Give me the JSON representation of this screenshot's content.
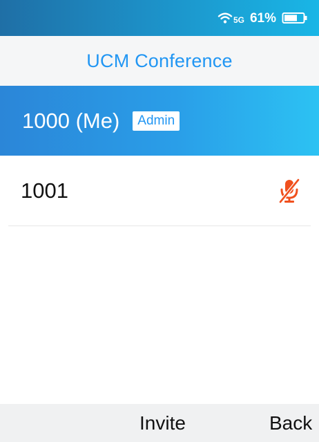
{
  "status_bar": {
    "wifi_label": "5G",
    "battery_percent": "61%",
    "icons": [
      "wifi-icon",
      "battery-icon"
    ]
  },
  "header": {
    "title": "UCM Conference"
  },
  "participants": [
    {
      "label": "1000 (Me)",
      "badge": "Admin",
      "selected": true,
      "muted": false
    },
    {
      "label": "1001",
      "badge": "",
      "selected": false,
      "muted": true,
      "status_icon": "mic-muted-icon"
    }
  ],
  "softkeys": {
    "left": "",
    "middle": "Invite",
    "right": "Back"
  },
  "colors": {
    "accent": "#2196f3",
    "selected_row": "#2a9ee8",
    "muted_icon": "#f0501e"
  }
}
